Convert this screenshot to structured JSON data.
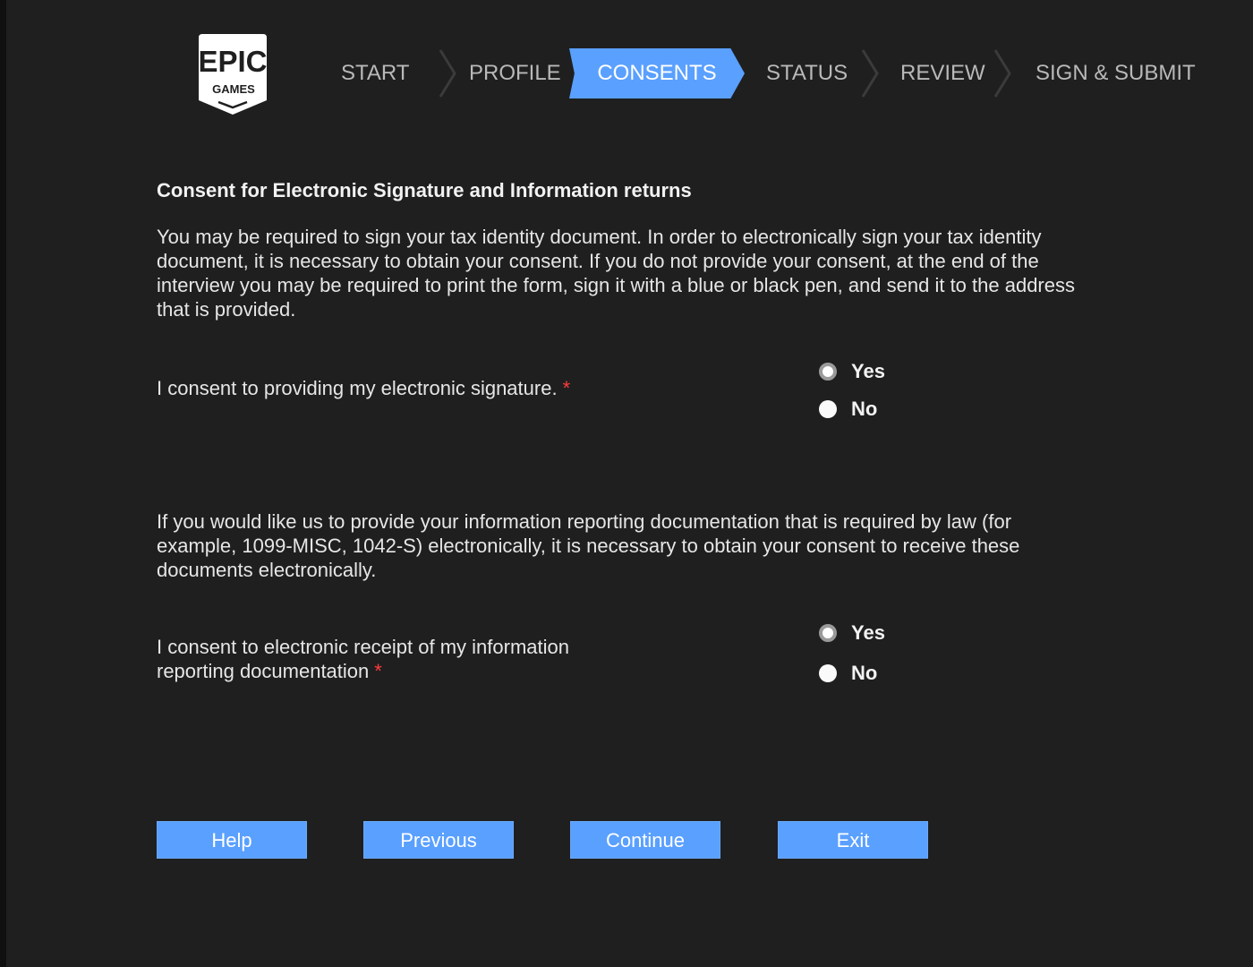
{
  "brand": {
    "logo_line1": "EPIC",
    "logo_line2": "GAMES"
  },
  "steps": [
    {
      "label": "START",
      "active": false
    },
    {
      "label": "PROFILE",
      "active": false
    },
    {
      "label": "CONSENTS",
      "active": true
    },
    {
      "label": "STATUS",
      "active": false
    },
    {
      "label": "REVIEW",
      "active": false
    },
    {
      "label": "SIGN & SUBMIT",
      "active": false
    }
  ],
  "consent": {
    "title": "Consent for Electronic Signature and Information returns",
    "intro": "You may be required to sign your tax identity document. In order to electronically sign your tax identity document, it is necessary to obtain your consent. If you do not provide your consent, at the end of the interview you may be required to print the form, sign it with a blue or black pen, and send it to the address that is provided.",
    "q1_label": "I consent to providing my electronic signature.",
    "q1_yes": "Yes",
    "q1_no": "No",
    "info": "If you would like us to provide your information reporting documentation that is required by law (for example, 1099-MISC, 1042-S) electronically, it is necessary to obtain your consent to receive these documents electronically.",
    "q2_label": "I consent to electronic receipt of my information reporting documentation",
    "q2_yes": "Yes",
    "q2_no": "No",
    "required_mark": "*"
  },
  "buttons": {
    "help": "Help",
    "previous": "Previous",
    "continue": "Continue",
    "exit": "Exit"
  },
  "colors": {
    "accent": "#5aa0ff",
    "background": "#1f1f20",
    "required": "#ff3b3b"
  }
}
